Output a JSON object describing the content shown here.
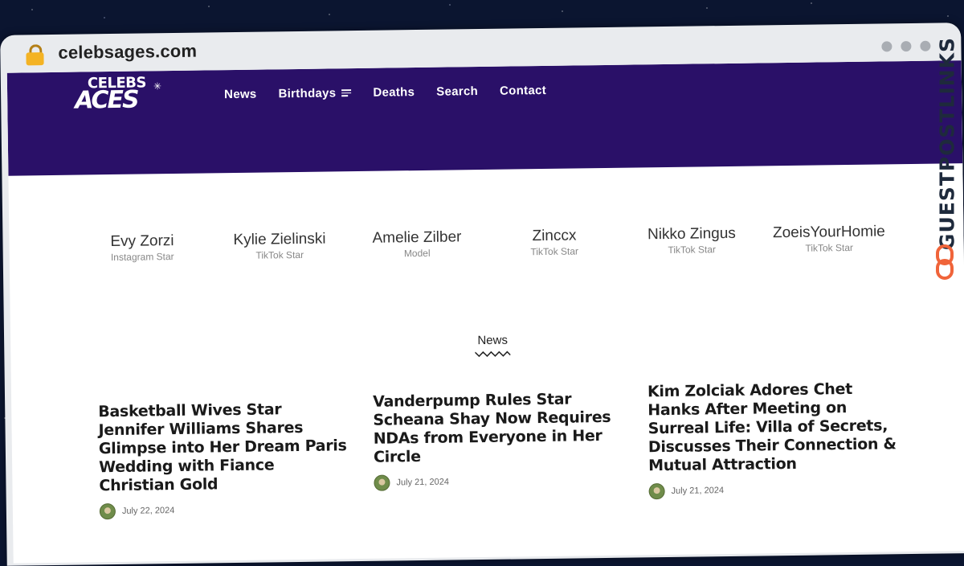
{
  "browser": {
    "url": "celebsages.com",
    "lock_icon": "lock-icon"
  },
  "site": {
    "logo_line1": "CELEBS",
    "logo_line2": "ACES",
    "nav": [
      {
        "label": "News"
      },
      {
        "label": "Birthdays"
      },
      {
        "label": "Deaths"
      },
      {
        "label": "Search"
      },
      {
        "label": "Contact"
      }
    ]
  },
  "people": [
    {
      "name": "Evy Zorzi",
      "role": "Instagram Star"
    },
    {
      "name": "Kylie Zielinski",
      "role": "TikTok Star"
    },
    {
      "name": "Amelie Zilber",
      "role": "Model"
    },
    {
      "name": "Zinccx",
      "role": "TikTok Star"
    },
    {
      "name": "Nikko Zingus",
      "role": "TikTok Star"
    },
    {
      "name": "ZoeisYourHomie",
      "role": "TikTok Star"
    }
  ],
  "news": {
    "heading": "News",
    "articles": [
      {
        "title": "Basketball Wives Star Jennifer Williams Shares Glimpse into Her Dream Paris Wedding with Fiance Christian Gold",
        "date": "July 22, 2024"
      },
      {
        "title": "Vanderpump Rules Star Scheana Shay Now Requires NDAs from Everyone in Her Circle",
        "date": "July 21, 2024"
      },
      {
        "title": "Kim Zolciak Adores Chet Hanks After Meeting on Surreal Life: Villa of Secrets, Discusses Their Connection & Mutual Attraction",
        "date": "July 21, 2024"
      }
    ]
  },
  "watermark": "GUESTPOSTLINKS",
  "colors": {
    "header_bg": "#2a1068",
    "watermark_accent": "#f0643a"
  }
}
